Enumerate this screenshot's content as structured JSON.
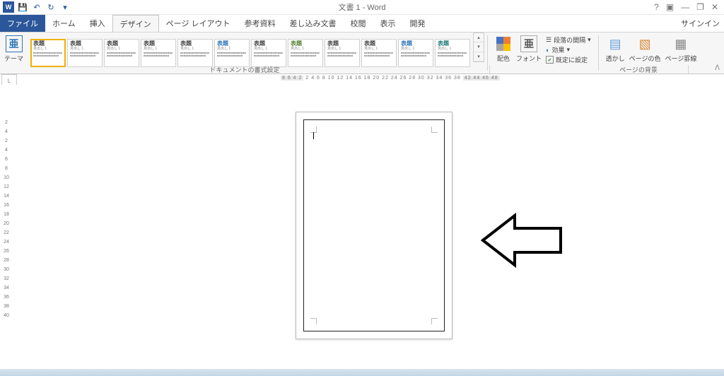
{
  "window": {
    "title": "文書 1 - Word",
    "sign_in": "サインイン"
  },
  "qat": {
    "word": "W",
    "save": "💾",
    "undo": "↶",
    "redo": "↻",
    "custom": "▾"
  },
  "win": {
    "help": "?",
    "ribbon_opts": "▣",
    "min": "—",
    "restore": "❐",
    "close": "✕"
  },
  "tabs": {
    "file": "ファイル",
    "home": "ホーム",
    "insert": "挿入",
    "design": "デザイン",
    "layout": "ページ レイアウト",
    "references": "参考資料",
    "mail": "差し込み文書",
    "review": "校閲",
    "view": "表示",
    "dev": "開発"
  },
  "styles": [
    {
      "title": "表題",
      "sub": "見出し 1",
      "color": "black",
      "selected": true
    },
    {
      "title": "表題",
      "sub": "見出し 1",
      "color": "black"
    },
    {
      "title": "表題",
      "sub": "見出し 1",
      "color": "black"
    },
    {
      "title": "表題",
      "sub": "見出し 1",
      "color": "black"
    },
    {
      "title": "表題",
      "sub": "見出し 1",
      "color": "black"
    },
    {
      "title": "表題",
      "sub": "見出し 1",
      "color": "blue"
    },
    {
      "title": "表題",
      "sub": "見出し 1",
      "color": "black"
    },
    {
      "title": "表題",
      "sub": "見出し 1",
      "color": "green"
    },
    {
      "title": "表題",
      "sub": "見出し 1",
      "color": "black"
    },
    {
      "title": "表題",
      "sub": "見出し 1",
      "color": "black"
    },
    {
      "title": "表題",
      "sub": "見出し 1",
      "color": "blue"
    },
    {
      "title": "表題",
      "sub": "見出し 1",
      "color": "teal"
    }
  ],
  "ribbon": {
    "themes": "テーマ",
    "colors": "配色",
    "fonts": "フォント",
    "font_glyph": "亜",
    "para_spacing": "段落の間隔",
    "effects": "効果",
    "set_default": "既定に設定",
    "watermark": "透かし",
    "page_color": "ページの色",
    "page_border": "ページ罫線",
    "group_format": "ドキュメントの書式設定",
    "group_bg": "ページの背景",
    "collapse": "ᐱ"
  },
  "ruler": {
    "left": "8 6 4 2",
    "mid": "2  4  6  8 10 12 14 16 18 20 22 24 26 28 30 32 34 36 38",
    "right": "42 44 46 48",
    "v": [
      "2",
      "4",
      "2",
      "4",
      "6",
      "8",
      "10",
      "12",
      "14",
      "16",
      "18",
      "20",
      "22",
      "24",
      "26",
      "28",
      "30",
      "32",
      "34",
      "36",
      "38",
      "40"
    ]
  }
}
